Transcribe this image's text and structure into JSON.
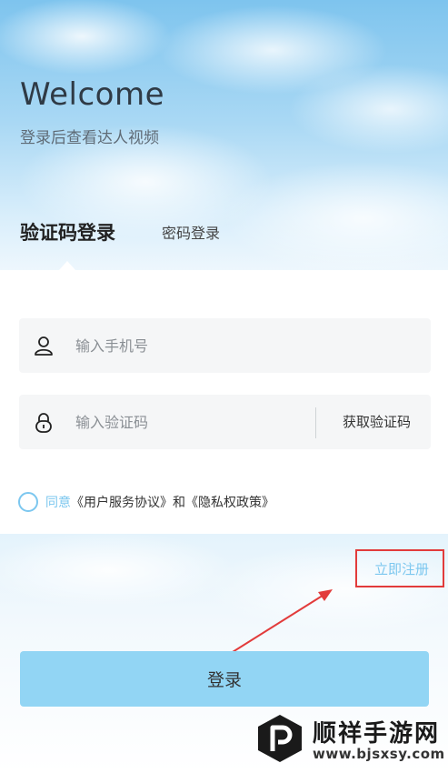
{
  "header": {
    "title": "Welcome",
    "subtitle": "登录后查看达人视频"
  },
  "tabs": [
    {
      "label": "验证码登录",
      "active": true
    },
    {
      "label": "密码登录",
      "active": false
    }
  ],
  "form": {
    "phone_placeholder": "输入手机号",
    "code_placeholder": "输入验证码",
    "get_code_label": "获取验证码",
    "phone_icon": "user-icon",
    "code_icon": "lock-icon"
  },
  "agreement": {
    "prefix": "同意",
    "user_terms": "《用户服务协议》",
    "and": "和",
    "privacy": "《隐私权政策》"
  },
  "register_label": "立即注册",
  "login_label": "登录",
  "colors": {
    "accent": "#7cc7ef",
    "login_button": "#92d5f4",
    "highlight": "#e23b3b"
  },
  "watermark": {
    "title": "顺祥手游网",
    "url": "www.bjsxsy.com"
  }
}
